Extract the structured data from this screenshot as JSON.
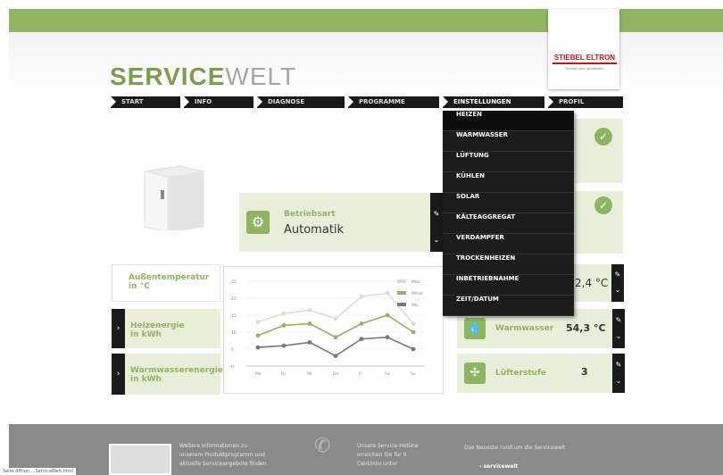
{
  "brand": {
    "strong": "SERVICE",
    "light": "WELT"
  },
  "logo": {
    "name": "STIEBEL ELTRON",
    "tagline": "Technik zum Wohlfühlen"
  },
  "nav": [
    "START",
    "INFO",
    "DIAGNOSE",
    "PROGRAMME",
    "EINSTELLUNGEN",
    "PROFIL"
  ],
  "dropdown": [
    "HEIZEN",
    "WARMWASSER",
    "LÜFTUNG",
    "KÜHLEN",
    "SOLAR",
    "KÄLTEAGGREGAT",
    "VERDAMPFER",
    "TROCKENHEIZEN",
    "INBETRIEBNAHME",
    "ZEIT/DATUM"
  ],
  "mode": {
    "label": "Betriebsart",
    "value": "Automatik"
  },
  "outdoor": {
    "label": "Außentemperatur",
    "unit": "in °C",
    "value": "2,4 °C"
  },
  "side_panels": [
    {
      "label": "Heizenergie",
      "unit": "in kWh"
    },
    {
      "label": "Warmwasserenergie",
      "unit": "in kWh"
    }
  ],
  "warmwater": {
    "label": "Warmwasser",
    "value": "54,3 °C"
  },
  "fan": {
    "label": "Lüfterstufe",
    "value": "3"
  },
  "chart_data": {
    "type": "line",
    "categories": [
      "Mo",
      "Di",
      "Mi",
      "Do",
      "Fr",
      "Sa",
      "So"
    ],
    "ylim": [
      0,
      25
    ],
    "yticks": [
      "0",
      "5",
      "10",
      "15",
      "20",
      "25"
    ],
    "legend_position": "top-right",
    "series": [
      {
        "name": "Max",
        "color": "#d9dfd0",
        "values": [
          13,
          15.5,
          16.5,
          14,
          20.5,
          21.5,
          12.5
        ]
      },
      {
        "name": "Mittel",
        "color": "#8fb463",
        "values": [
          9,
          12,
          12.5,
          8.5,
          12.5,
          15,
          10
        ]
      },
      {
        "name": "Min",
        "color": "#777777",
        "values": [
          5.5,
          6,
          7,
          3,
          8,
          8.5,
          5
        ]
      }
    ]
  },
  "footer": {
    "col1": [
      "Weitere Informationen zu",
      "unserem Produktprogramm und",
      "aktuelle Serviceangebote finden"
    ],
    "col2": [
      "Unsere Service-Hotline",
      "erreichen Sie für 9",
      "Cent/min unter"
    ],
    "col3_title": "Das Neueste rund um die Servicewelt",
    "col3_link": "servicewelt"
  },
  "status_bar": "Seite öffnen ...ServiceWelt.html"
}
